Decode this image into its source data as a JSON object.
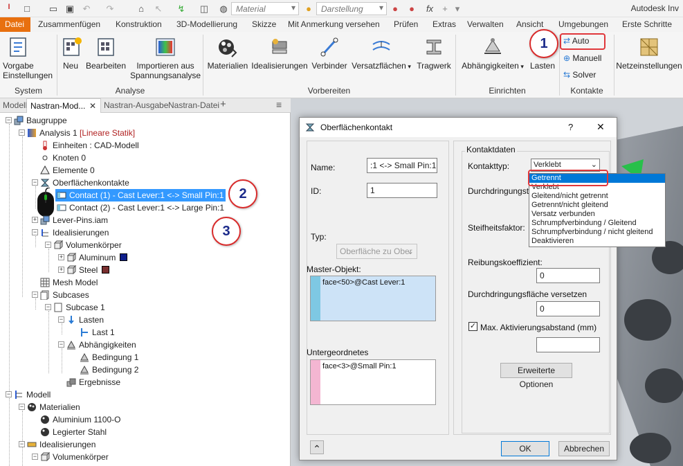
{
  "qat": {
    "material_placeholder": "Material",
    "appearance_placeholder": "Darstellung",
    "fx": "fx"
  },
  "app_title": "Autodesk Inv",
  "menu": [
    "Datei",
    "Zusammenfügen",
    "Konstruktion",
    "3D-Modellierung",
    "Skizze",
    "Mit Anmerkung versehen",
    "Prüfen",
    "Extras",
    "Verwalten",
    "Ansicht",
    "Umgebungen",
    "Erste Schritte"
  ],
  "ribbon": {
    "vorgabe_l1": "Vorgabe",
    "vorgabe_l2": "Einstellungen",
    "grp_system": "System",
    "neu": "Neu",
    "bearbeiten": "Bearbeiten",
    "importieren_l1": "Importieren aus",
    "importieren_l2": "Spannungsanalyse",
    "grp_analyse": "Analyse",
    "materialien": "Materialien",
    "idealisierungen": "Idealisierungen",
    "verbinder": "Verbinder",
    "satzflaechen": "Versatzflächen",
    "tragwerk": "Tragwerk",
    "grp_vorbereiten": "Vorbereiten",
    "abhaengigkeiten": "Abhängigkeiten",
    "lasten": "Lasten",
    "grp_einrichten": "Einrichten",
    "auto": "Auto",
    "manuell": "Manuell",
    "solver": "Solver",
    "grp_kontakte": "Kontakte",
    "netz": "Netzeinstellungen"
  },
  "browser_tabs": {
    "t1": "Modell",
    "t2": "Nastran-Mod...",
    "t3": "Nastran-Ausgabe",
    "t4": "Nastran-Datei"
  },
  "tree": {
    "baugruppe": "Baugruppe",
    "analysis": "Analysis 1",
    "analysis_type": "[Lineare Statik]",
    "einheiten": "Einheiten : CAD-Modell",
    "knoten": "Knoten 0",
    "elemente": "Elemente 0",
    "oberflaechenkontakte": "Oberflächenkontakte",
    "contact1": "Contact (1) - Cast Lever:1 <-> Small Pin:1",
    "contact2": "Contact (2) - Cast Lever:1 <-> Large Pin:1",
    "lever_pins": "Lever-Pins.iam",
    "idealisierungen": "Idealisierungen",
    "volumenkoerper": "Volumenkörper",
    "aluminum": "Aluminum",
    "steel": "Steel",
    "mesh": "Mesh Model",
    "subcases": "Subcases",
    "subcase1": "Subcase 1",
    "lasten": "Lasten",
    "last1": "Last 1",
    "abhaengigkeiten": "Abhängigkeiten",
    "bedingung1": "Bedingung 1",
    "bedingung2": "Bedingung 2",
    "ergebnisse": "Ergebnisse",
    "modell": "Modell",
    "materialien": "Materialien",
    "alu1100": "Aluminium 1100-O",
    "legierter": "Legierter Stahl",
    "idealisierungen2": "Idealisierungen",
    "volumenkoerper2": "Volumenkörper"
  },
  "dialog": {
    "title": "Oberflächenkontakt",
    "help": "?",
    "close": "✕",
    "name_label": "Name:",
    "name_value": ":1 <-> Small Pin:1",
    "id_label": "ID:",
    "id_value": "1",
    "typ_label": "Typ:",
    "typ_value": "Oberfläche zu Ober",
    "master_label": "Master-Objekt:",
    "master_value": "face<50>@Cast Lever:1",
    "sub_label": "Untergeordnetes",
    "sub_value": "face<3>@Small Pin:1",
    "kontaktdaten": "Kontaktdaten",
    "kontakttyp_label": "Kontakttyp:",
    "kontakttyp_value": "Verklebt",
    "durchdringung_label": "Durchdringungstyp",
    "steifheit_label": "Steifheitsfaktor:",
    "reibung_label": "Reibungskoeffizient:",
    "reibung_value": "0",
    "versetzen_label": "Durchdringungsfläche versetzen",
    "versetzen_value": "0",
    "max_label": "Max. Aktivierungsabstand (mm)",
    "max_value": "",
    "erweiterte": "Erweiterte Optionen",
    "ok": "OK",
    "abbrechen": "Abbrechen",
    "expand": "⌃"
  },
  "dropdown_options": [
    "Getrennt",
    "Verklebt",
    "Gleitend/nicht getrennt",
    "Getrennt/nicht gleitend",
    "Versatz verbunden",
    "Schrumpfverbindung / Gleitend",
    "Schrumpfverbindung / nicht gleitend",
    "Deaktivieren"
  ],
  "callouts": {
    "c1": "1",
    "c2": "2",
    "c3": "3"
  },
  "colors": {
    "accent": "#e8700f",
    "selection": "#3399ff",
    "callout_border": "#d92b2b",
    "aluminum_swatch": "#0f1f8a",
    "steel_swatch": "#7a3030",
    "master_bar": "#7ec8e3",
    "sub_bar": "#f4b6d2"
  }
}
